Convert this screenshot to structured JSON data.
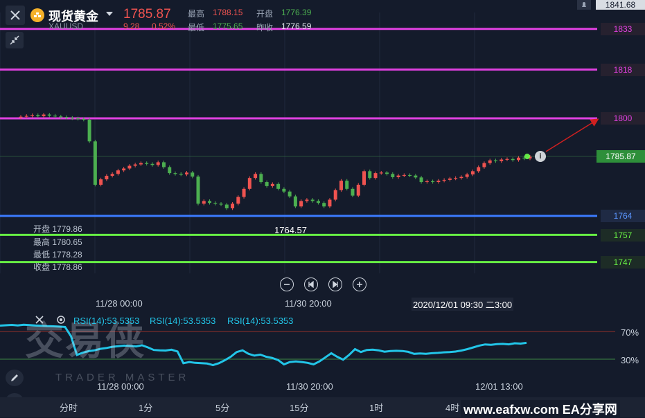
{
  "header": {
    "title": "现货黄金",
    "symbol": "XAUUSD",
    "price": "1785.87",
    "change": "9.28",
    "change_pct": "0.52%",
    "high_label": "最高",
    "high": "1788.15",
    "open_label": "开盘",
    "open": "1776.39",
    "low_label": "最低",
    "low": "1775.65",
    "prev_close_label": "昨收",
    "prev_close": "1776.59",
    "top_right_price": "1841.68"
  },
  "price_levels": [
    {
      "value": "1833",
      "color": "#e040e0"
    },
    {
      "value": "1818",
      "color": "#e040e0"
    },
    {
      "value": "1800",
      "color": "#e040e0"
    },
    {
      "value": "1764",
      "color": "#3b7bff"
    },
    {
      "value": "1757",
      "color": "#66ee44"
    },
    {
      "value": "1747",
      "color": "#66ee44"
    }
  ],
  "current_price_tag": "1785.87",
  "low_marker": "1764.57",
  "ohlc_box": {
    "open": "开盘 1779.86",
    "high": "最高 1780.65",
    "low": "最低 1778.28",
    "close": "收盘 1778.86"
  },
  "time_axis": {
    "main": [
      "11/28 00:00",
      "11/30 20:00"
    ],
    "cursor_time": "2020/12/01 09:30 二3:00",
    "rsi": [
      "11/28 00:00",
      "11/30 20:00",
      "12/01 13:00"
    ]
  },
  "rsi": {
    "labels": [
      "RSI(14):53.5353",
      "RSI(14):53.5353",
      "RSI(14):53.5353"
    ],
    "level_high": "70%",
    "level_low": "30%"
  },
  "tabs": [
    "分时",
    "1分",
    "5分",
    "15分",
    "1时",
    "4时"
  ],
  "watermark": {
    "big": "交易侠",
    "small": "TRADER MASTER"
  },
  "footer_watermark": "www.eafxw.com  EA分享网",
  "colors": {
    "up": "#ef5350",
    "down": "#4caf50",
    "rsi": "#22c5e8"
  },
  "chart_data": {
    "type": "candlestick",
    "candles_close": [
      1800.6,
      1800.9,
      1801.2,
      1800.8,
      1801.4,
      1801.0,
      1800.7,
      1800.5,
      1800.2,
      1800.0,
      1799.8,
      1799.5,
      1791.5,
      1775.5,
      1777.5,
      1778.8,
      1779.5,
      1780.8,
      1781.5,
      1782.5,
      1783.0,
      1783.5,
      1783.2,
      1782.8,
      1783.8,
      1782.0,
      1779.8,
      1779.5,
      1779.3,
      1780.0,
      1778.5,
      1768.5,
      1769.5,
      1768.8,
      1768.5,
      1768.2,
      1766.8,
      1768.5,
      1771.0,
      1774.0,
      1778.0,
      1779.5,
      1776.5,
      1775.0,
      1775.8,
      1774.0,
      1773.0,
      1771.2,
      1767.5,
      1769.5,
      1770.0,
      1769.5,
      1768.8,
      1767.5,
      1770.0,
      1773.5,
      1777.0,
      1774.0,
      1771.5,
      1775.5,
      1780.5,
      1778.0,
      1779.8,
      1780.0,
      1779.5,
      1778.3,
      1778.9,
      1779.1,
      1778.9,
      1778.2,
      1776.5,
      1776.8,
      1776.5,
      1777.0,
      1777.3,
      1777.8,
      1778.0,
      1778.4,
      1779.3,
      1780.5,
      1782.0,
      1783.5,
      1784.5,
      1784.2,
      1784.8,
      1785.0,
      1784.6,
      1785.5,
      1785.2,
      1785.87
    ]
  }
}
